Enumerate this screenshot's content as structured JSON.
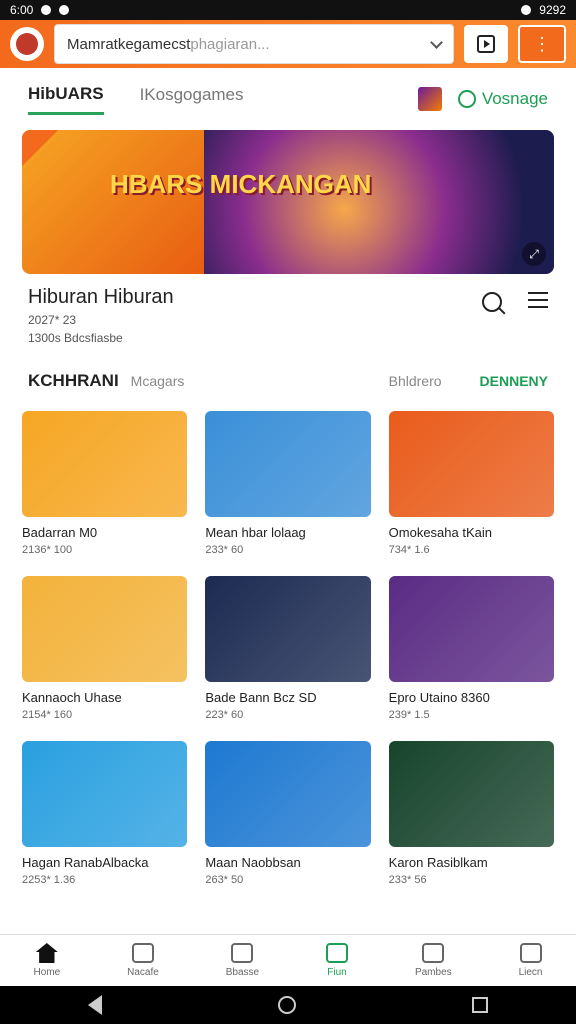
{
  "status": {
    "time": "6:00",
    "right": "9292"
  },
  "search": {
    "value": "Mamratkegamecst",
    "placeholder": "phagiaran..."
  },
  "tabs": [
    {
      "label": "HibUARS"
    },
    {
      "label": "IKosgogames"
    }
  ],
  "tab_right": {
    "label": "Vosnage"
  },
  "hero": {
    "title": "HBARS MICKANGAN"
  },
  "meta": {
    "title": "Hiburan Hiburan",
    "sub": "2027* 23",
    "downloads": "1300s Bdcsfiasbe"
  },
  "section": {
    "title": "KCHHRANI",
    "subtitle": "Mcagars",
    "filter": "Bhldrero",
    "more": "DENNENY"
  },
  "cards": [
    {
      "name": "Badarran M0",
      "stat": "2136* 100",
      "color": "#f6a623"
    },
    {
      "name": "Mean hbar lolaag",
      "stat": "233* 60",
      "color": "#3a8fd8"
    },
    {
      "name": "Omokesaha tKain",
      "stat": "734* 1.6",
      "color": "#e95c1b"
    },
    {
      "name": "Kannaoch Uhase",
      "stat": "2154* 160",
      "color": "#f3b23a"
    },
    {
      "name": "Bade Bann Bcz SD",
      "stat": "223* 60",
      "color": "#1c2a52"
    },
    {
      "name": "Epro Utaino 8360",
      "stat": "239* 1.5",
      "color": "#5a2b84"
    },
    {
      "name": "Hagan RanabAlbacka",
      "stat": "2253* 1.36",
      "color": "#2aa0e0"
    },
    {
      "name": "Maan Naobbsan",
      "stat": "263* 50",
      "color": "#1e79d1"
    },
    {
      "name": "Karon Rasiblkam",
      "stat": "233* 56",
      "color": "#17442c"
    }
  ],
  "nav": [
    {
      "label": "Home"
    },
    {
      "label": "Nacafe"
    },
    {
      "label": "Bbasse"
    },
    {
      "label": "Fiun"
    },
    {
      "label": "Pambes"
    },
    {
      "label": "Liecn"
    }
  ]
}
